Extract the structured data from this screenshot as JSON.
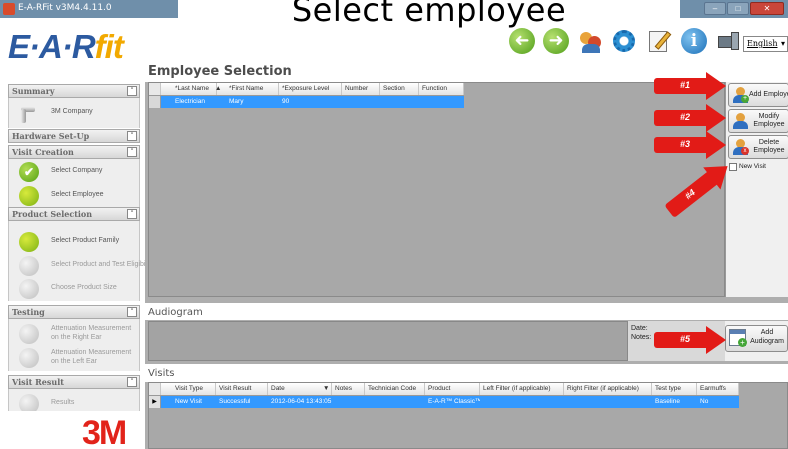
{
  "window": {
    "title": "E-A-RFit v3M4.4.11.0",
    "min": "–",
    "max": "□",
    "close": "✕"
  },
  "banner": {
    "text": "Select employee"
  },
  "logo": {
    "ear": "E·A·R",
    "fit": "fit"
  },
  "toolbar": {
    "icons": [
      "back-arrow-icon",
      "forward-arrow-icon",
      "users-icon",
      "gear-icon",
      "edit-icon",
      "info-icon",
      "computer-icon"
    ],
    "back_glyph": "➜",
    "fwd_glyph": "➜",
    "info_glyph": "i",
    "language": "English",
    "language_arrow": "▾"
  },
  "sidebar": {
    "summary": {
      "title": "Summary",
      "toggle": "˄",
      "item": "3M Company"
    },
    "hardware": {
      "title": "Hardware Set-Up",
      "toggle": "˅"
    },
    "visit_creation": {
      "title": "Visit Creation",
      "toggle": "˄",
      "items": [
        "Select Company",
        "Select Employee"
      ],
      "check": "✔"
    },
    "product_selection": {
      "title": "Product Selection",
      "toggle": "˄",
      "items": [
        "Select Product Family",
        "Select Product and Test Eligibility",
        "Choose Product Size"
      ]
    },
    "testing": {
      "title": "Testing",
      "toggle": "˄",
      "items": [
        "Attenuation Measurement on the Right Ear",
        "Attenuation Measurement on the Left Ear"
      ]
    },
    "visit_result": {
      "title": "Visit Result",
      "toggle": "˄",
      "items": [
        "Results"
      ]
    },
    "brand": "3M"
  },
  "employee_selection": {
    "title": "Employee Selection",
    "columns": [
      "*Last Name",
      "▲",
      "*First Name",
      "*Exposure Level",
      "Number",
      "Section",
      "Function"
    ],
    "rows": [
      {
        "last_name": "Electrician",
        "first_name": "Mary",
        "exposure": "90",
        "number": "",
        "section": "",
        "function": ""
      }
    ]
  },
  "actions": {
    "add_employee": "Add Employee",
    "modify_employee": [
      "Modify",
      "Employee"
    ],
    "delete_employee": [
      "Delete",
      "Employee"
    ],
    "new_visit": "New Visit",
    "add_audiogram": [
      "Add",
      "Audiogram"
    ]
  },
  "annotations": [
    "#1",
    "#2",
    "#3",
    "#4",
    "#5"
  ],
  "annotation_color": "#e21b17",
  "audiogram": {
    "title": "Audiogram",
    "date_label": "Date:",
    "notes_label": "Notes:"
  },
  "visits": {
    "title": "Visits",
    "columns": [
      "Visit Type",
      "Visit Result",
      "Date",
      "▼",
      "Notes",
      "Technician Code",
      "Product",
      "Left Filter (if applicable)",
      "Right Filter (if applicable)",
      "Test type",
      "Earmuffs"
    ],
    "rows": [
      {
        "pointer": "▶",
        "visit_type": "New Visit",
        "visit_result": "Successful",
        "date": "2012-06-04 13:43:05",
        "notes": "",
        "technician_code": "",
        "product": "E-A-R™ Classic™",
        "left_filter": "",
        "right_filter": "",
        "test_type": "Baseline",
        "earmuffs": "No"
      }
    ]
  },
  "colors": {
    "selection": "#3399ff",
    "brand_blue": "#2c5aa0",
    "brand_yellow": "#f2a900",
    "brand_red": "#e2231a"
  }
}
